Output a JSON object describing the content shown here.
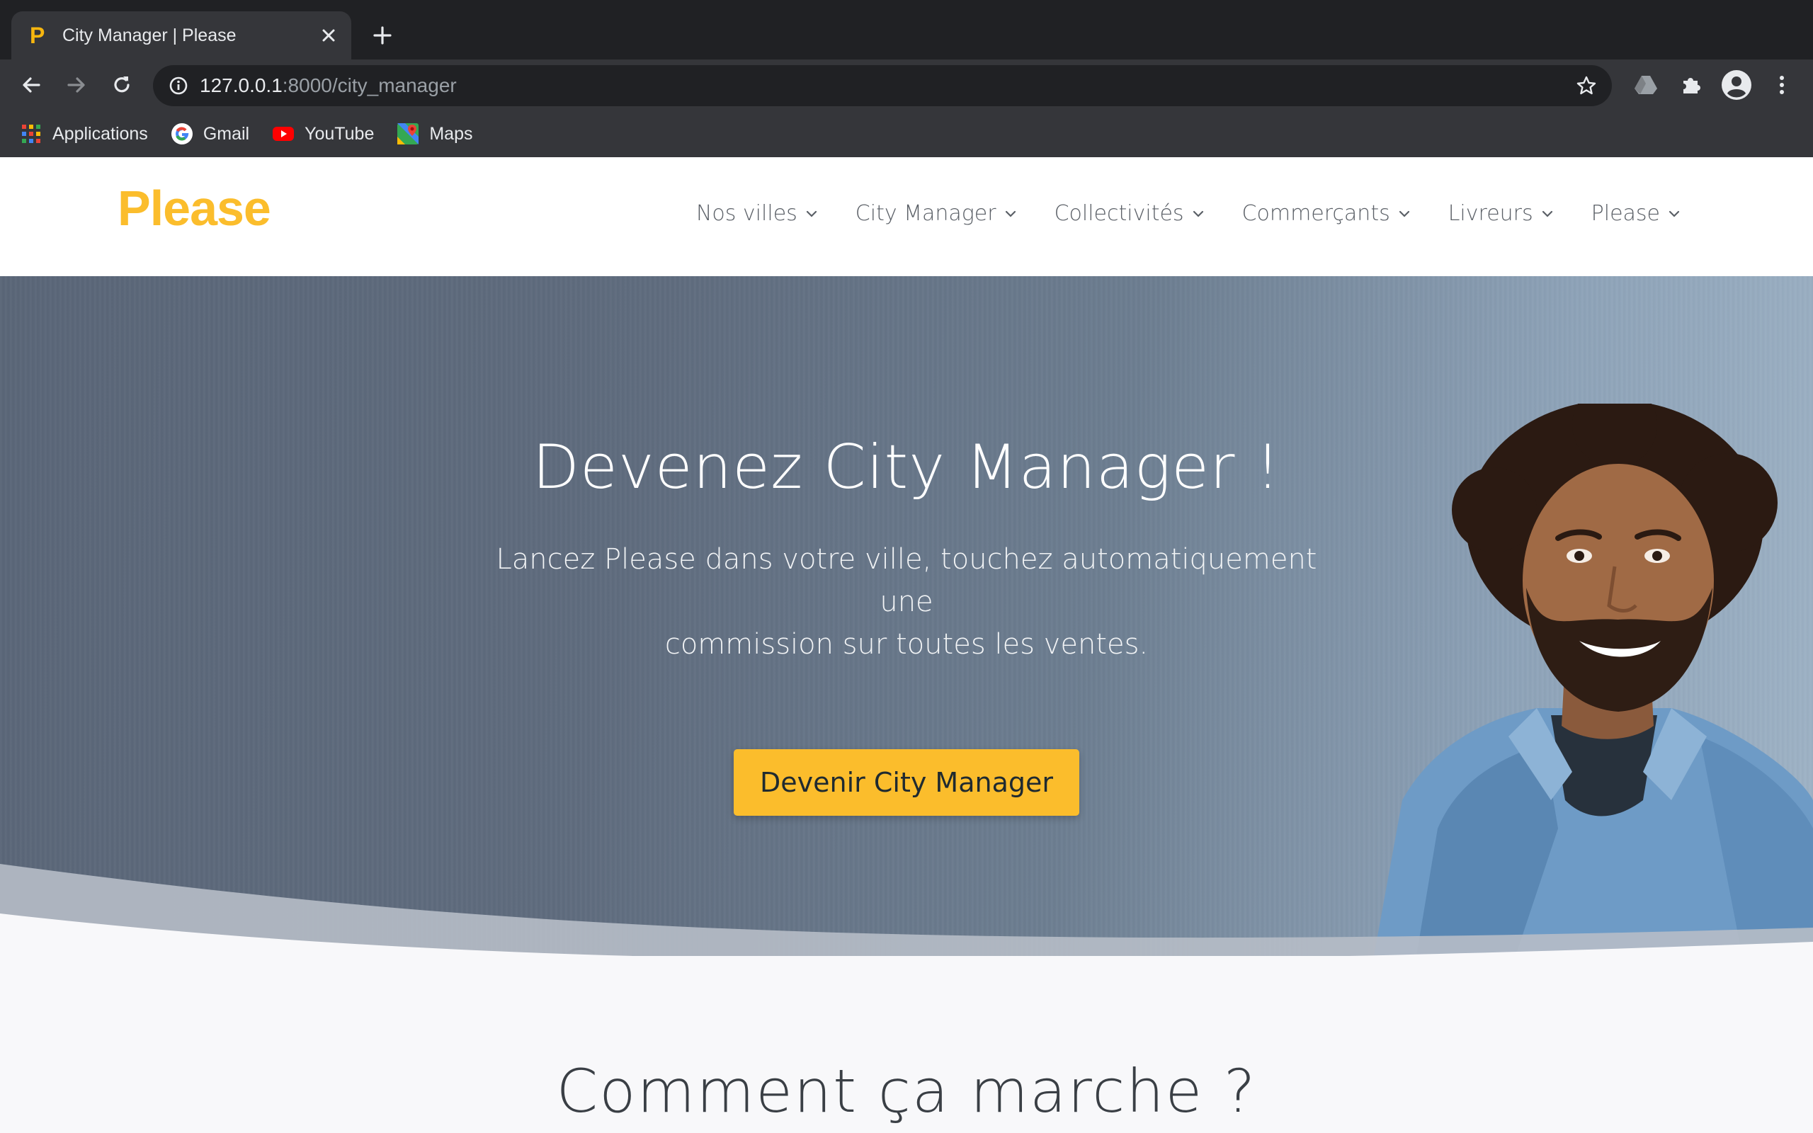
{
  "browser": {
    "tab": {
      "title": "City Manager | Please",
      "favicon_letter": "P"
    },
    "omnibox": {
      "url_host": "127.0.0.1",
      "url_path": ":8000/city_manager"
    },
    "bookmarks": [
      {
        "label": "Applications",
        "icon": "apps-grid-icon"
      },
      {
        "label": "Gmail",
        "icon": "google-icon"
      },
      {
        "label": "YouTube",
        "icon": "youtube-icon"
      },
      {
        "label": "Maps",
        "icon": "maps-icon"
      }
    ]
  },
  "site": {
    "logo": "Please",
    "brand_color": "#fbbd2c",
    "nav": [
      {
        "label": "Nos villes"
      },
      {
        "label": "City Manager"
      },
      {
        "label": "Collectivités"
      },
      {
        "label": "Commerçants"
      },
      {
        "label": "Livreurs"
      },
      {
        "label": "Please"
      }
    ],
    "hero": {
      "title": "Devenez City Manager !",
      "subtitle_line1": "Lancez Please dans votre ville, touchez automatiquement une",
      "subtitle_line2": "commission sur toutes les ventes.",
      "cta": "Devenir City Manager"
    },
    "section": {
      "title": "Comment ça marche ?"
    }
  }
}
